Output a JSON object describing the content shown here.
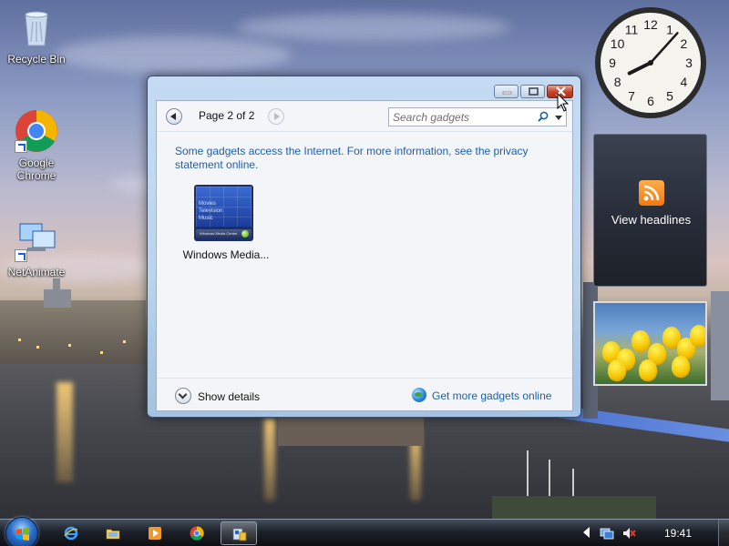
{
  "desktop": {
    "icons": [
      {
        "label": "Recycle Bin",
        "icon": "recycle-bin-icon"
      },
      {
        "label": "Google Chrome",
        "icon": "chrome-icon"
      },
      {
        "label": "NetAnimate",
        "icon": "netanimate-icon"
      }
    ]
  },
  "gadgets": {
    "clock": {
      "hour": 8,
      "minute": 7,
      "numerals": [
        "12",
        "1",
        "2",
        "3",
        "4",
        "5",
        "6",
        "7",
        "8",
        "9",
        "10",
        "11"
      ]
    },
    "feed": {
      "label": "View headlines",
      "icon": "rss-icon"
    },
    "slideshow": {
      "subject": "tulips"
    }
  },
  "dialog": {
    "controls": {
      "minimize": "minimize-icon",
      "maximize": "maximize-icon",
      "close": "close-icon"
    },
    "page_label": "Page 2 of 2",
    "search_placeholder": "Search gadgets",
    "privacy_text": "Some gadgets access the Internet.  For more information, see the privacy statement online.",
    "gadget": {
      "name": "Windows Media...",
      "menu": [
        "Movies",
        "Television",
        "Music"
      ],
      "bar_text": "Windows Media Center"
    },
    "details_label": "Show details",
    "online_label": "Get more gadgets online"
  },
  "taskbar": {
    "pinned": [
      "internet-explorer-icon",
      "folder-icon",
      "media-player-icon",
      "chrome-icon",
      "gadgets-icon"
    ],
    "tray": [
      "action-center-icon",
      "volume-muted-icon"
    ],
    "time": "19:41"
  },
  "colors": {
    "link": "#1e5fa8",
    "close_button": "#c2432a",
    "taskbar": "#1c2028"
  }
}
